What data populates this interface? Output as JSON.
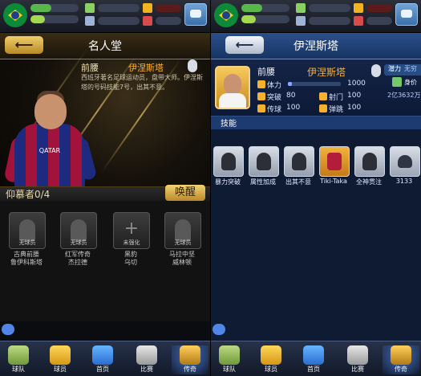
{
  "left": {
    "status": {
      "flag": "brazil-flag-icon",
      "lines": [
        "",
        "",
        ""
      ],
      "chat_icon": "chat-icon"
    },
    "title": "名人堂",
    "back_icon": "back-arrow-icon",
    "player": {
      "position": "前腰",
      "name": "伊涅斯塔",
      "description": "西班牙著名足球运动员，盘带大师。伊涅斯塔的号码技能7号，出其不意。",
      "sponsor_text": "QATAR"
    },
    "recruit_label": "仰慕者0/4",
    "wake_button": "唤醒",
    "slots": [
      {
        "label": "无球员",
        "name_line1": "古典前腰",
        "name_line2": "鲁伊科斯塔"
      },
      {
        "label": "无球员",
        "name_line1": "红军传奇",
        "name_line2": "杰拉德"
      },
      {
        "label": "未强化",
        "name_line1": "黑豹",
        "name_line2": "乌切"
      },
      {
        "label": "无球员",
        "name_line1": "马拉中坚",
        "name_line2": "威林顿"
      }
    ],
    "nav": [
      {
        "label": "球队",
        "icon": "clipboard-icon"
      },
      {
        "label": "球员",
        "icon": "player-card-icon"
      },
      {
        "label": "首页",
        "icon": "home-icon"
      },
      {
        "label": "比赛",
        "icon": "whistle-icon"
      },
      {
        "label": "传奇",
        "icon": "legend-cup-icon"
      }
    ]
  },
  "right": {
    "title": "伊涅斯塔",
    "back_icon": "back-arrow-icon",
    "player": {
      "position": "前腰",
      "name": "伊涅斯塔",
      "stamina_label": "体力",
      "stamina_value": "1000",
      "stamina_fill": 0.08,
      "breakthrough_label": "突破",
      "breakthrough_value": "80",
      "shoot_label": "射门",
      "shoot_value": "100",
      "pass_label": "传球",
      "pass_value": "100",
      "jump_label": "弹跳",
      "jump_value": "100"
    },
    "side_tags": {
      "potential": "潜力",
      "potential_value": "无穷",
      "value_label": "身价",
      "value_amount": "2亿3632万"
    },
    "skills_title": "技能",
    "skills": [
      {
        "name": "暴力突破",
        "icon": "power-dribble-icon"
      },
      {
        "name": "属性加成",
        "icon": "attribute-bonus-icon"
      },
      {
        "name": "出其不意",
        "icon": "surprise-icon"
      },
      {
        "name": "Tiki-Taka",
        "icon": "barca-crest-icon"
      },
      {
        "name": "全神贯注",
        "icon": "focus-icon"
      },
      {
        "name": "3133",
        "icon": "formation-icon"
      }
    ],
    "nav": [
      {
        "label": "球队",
        "icon": "clipboard-icon"
      },
      {
        "label": "球员",
        "icon": "player-card-icon"
      },
      {
        "label": "首页",
        "icon": "home-icon"
      },
      {
        "label": "比赛",
        "icon": "whistle-icon"
      },
      {
        "label": "传奇",
        "icon": "legend-cup-icon"
      }
    ]
  }
}
